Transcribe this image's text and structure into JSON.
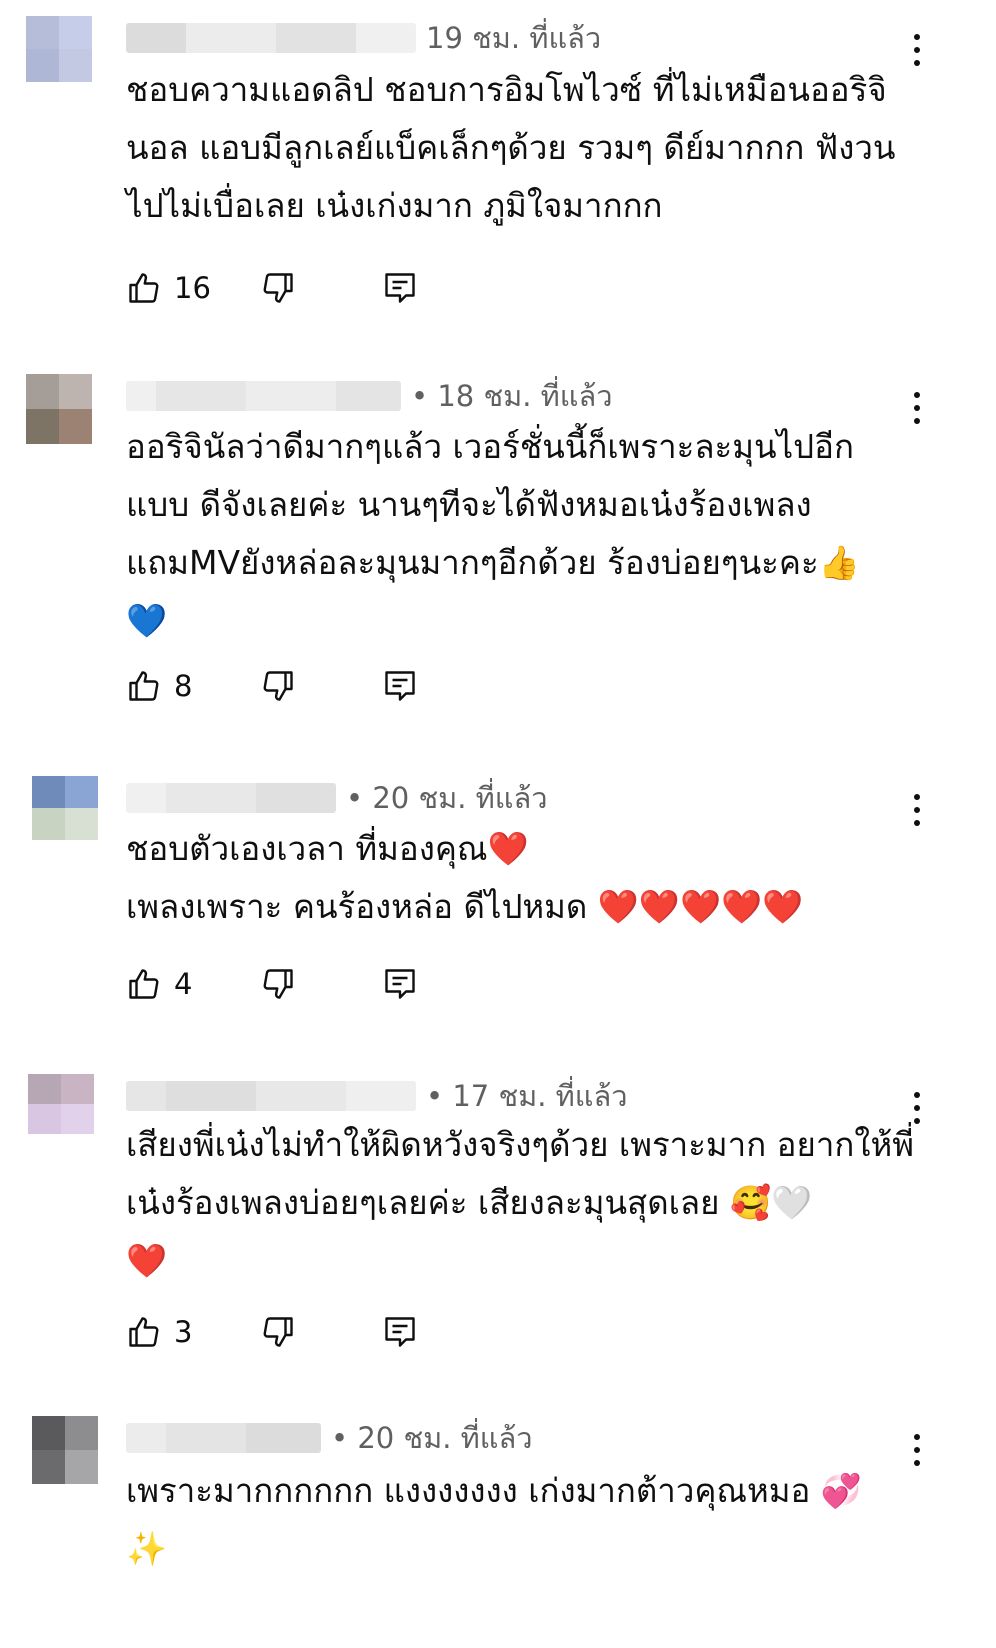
{
  "comments": [
    {
      "time": "19 ชม. ที่แล้ว",
      "text": "ชอบความแอดลิป ชอบการอิมโพไวซ์ ที่ไม่เหมือนออริจินอล แอบมีลูกเลย์แบ็คเล็กๆด้วย รวมๆ ดีย์มากกก ฟังวนไปไม่เบื่อเลย เน๋งเก่งมาก ภูมิใจมากกก",
      "likes": "16",
      "avatar_colors": [
        "#b5bdd9",
        "#c6cde8",
        "#aeb7d6",
        "#c3c9e3"
      ]
    },
    {
      "time": "• 18 ชม. ที่แล้ว",
      "text": "ออริจินัลว่าดีมากๆแล้ว เวอร์ชั่นนี้ก็เพราะละมุนไปอีกแบบ ดีจังเลยค่ะ นานๆทีจะได้ฟังหมอเน๋งร้องเพลงแถมMVยังหล่อละมุนมากๆอีกด้วย ร้องบ่อยๆนะคะ👍\n💙",
      "likes": "8",
      "avatar_colors": [
        "#a49d98",
        "#bdb4af",
        "#7d7466",
        "#9b8272"
      ]
    },
    {
      "time": "• 20 ชม. ที่แล้ว",
      "text": "ชอบตัวเองเวลา ที่มองคุณ❤️\nเพลงเพราะ คนร้องหล่อ ดีไปหมด ❤️❤️❤️❤️❤️",
      "likes": "4",
      "avatar_colors": [
        "#6f8bb9",
        "#8aa5d4",
        "#c8d3c2",
        "#d8e0d3"
      ]
    },
    {
      "time": "• 17 ชม. ที่แล้ว",
      "text": "เสียงพี่เน๋งไม่ทำให้ผิดหวังจริงๆด้วย เพราะมาก อยากให้พี่เน๋งร้องเพลงบ่อยๆเลยค่ะ เสียงละมุนสุดเลย 🥰🤍\n❤️",
      "likes": "3",
      "avatar_colors": [
        "#b7a7b5",
        "#c9b4c4",
        "#d9c6e3",
        "#e2d1ea"
      ]
    },
    {
      "time": "• 20 ชม. ที่แล้ว",
      "text": "เพราะมากกกกกก แงงงงงงง เก่งมากต้าวคุณหมอ 💞\n✨",
      "likes": "",
      "avatar_colors": [
        "#5a5a5c",
        "#8d8d90",
        "#6b6b6e",
        "#a6a6a9"
      ]
    }
  ]
}
